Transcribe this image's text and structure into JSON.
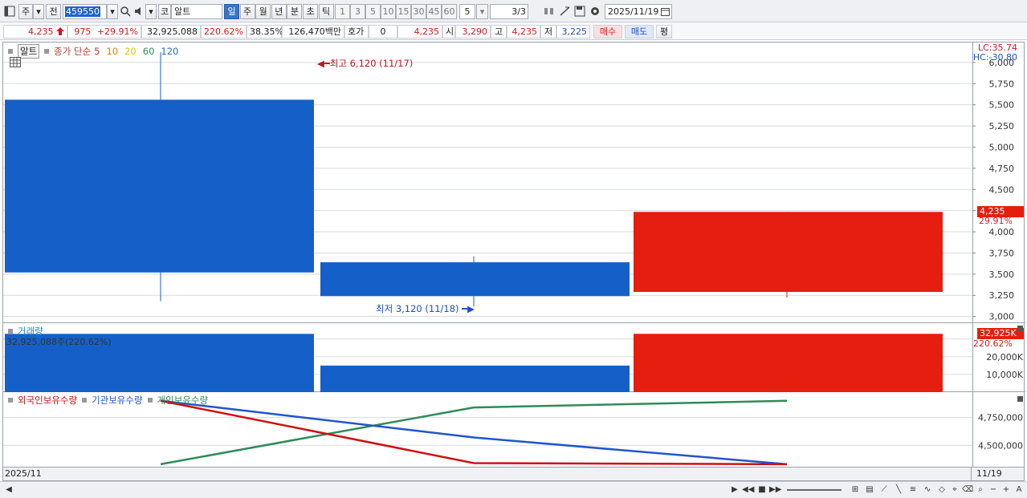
{
  "toolbar": {
    "market_type": "주",
    "prev_label": "전",
    "stock_code": "459550",
    "search_icon": "magnifier",
    "sound_icon": "speaker",
    "exchange_label": "코",
    "stock_name": "알트",
    "periods": [
      {
        "label": "일",
        "active": true
      },
      {
        "label": "주",
        "active": false
      },
      {
        "label": "월",
        "active": false
      },
      {
        "label": "년",
        "active": false
      },
      {
        "label": "분",
        "active": false
      },
      {
        "label": "초",
        "active": false
      },
      {
        "label": "틱",
        "active": false
      }
    ],
    "intervals": [
      "1",
      "3",
      "5",
      "10",
      "15",
      "30",
      "45",
      "60"
    ],
    "interval_value": "5",
    "count_value": "3",
    "count_total": "/3",
    "date_value": "2025/11/19"
  },
  "quote": {
    "price": "4,235",
    "price_arrow": "up-arrow",
    "change": "975",
    "change_pct": "+29.91%",
    "volume": "32,925,088",
    "volume_ratio": "220.62%",
    "turnover_rate": "38.35%",
    "amount": "126,470백만",
    "quote_label": "호가",
    "quote_value": "0",
    "quote_price": "4,235",
    "open_label": "시",
    "open_value": "3,290",
    "high_label": "고",
    "high_value": "4,235",
    "low_label": "저",
    "low_value": "3,225",
    "buy_label": "매수",
    "sell_label": "매도",
    "avg_label": "평"
  },
  "price_pane": {
    "legend": {
      "tag": "알트",
      "series_label": "종가 단순",
      "ma": [
        {
          "label": "5",
          "color": "#c0392b"
        },
        {
          "label": "10",
          "color": "#e07b00"
        },
        {
          "label": "20",
          "color": "#e6c300"
        },
        {
          "label": "60",
          "color": "#2e8b57"
        },
        {
          "label": "120",
          "color": "#2b6cb0"
        }
      ]
    },
    "lc_label": "LC:35.74",
    "hc_label": "HC:-30.80",
    "high_annotation": "최고 6,120 (11/17)",
    "low_annotation": "최저 3,120 (11/18)",
    "current_price_tag": "4,235",
    "current_change_tag": "29.91%",
    "up_color": "#e61e10",
    "down_color": "#1560c8"
  },
  "volume_pane": {
    "label": "거래량",
    "info": "32,925,088주(220.62%)",
    "current_tag": "32,925K",
    "current_pct": "220.62%"
  },
  "holdings_pane": {
    "legend": [
      {
        "label": "외국인보유수량",
        "color": "#cc1111"
      },
      {
        "label": "기관보유수량",
        "color": "#2255cc"
      },
      {
        "label": "개인보유수량",
        "color": "#2e8b57"
      }
    ]
  },
  "status": {
    "period": "2025/11",
    "current_date": "11/19"
  },
  "chart_data": [
    {
      "type": "candlestick",
      "categories": [
        "11/17",
        "11/18",
        "11/19"
      ],
      "series": [
        {
          "open": 5560,
          "high": 6120,
          "low": 3180,
          "close": 3520,
          "direction": "down"
        },
        {
          "open": 3640,
          "high": 3710,
          "low": 3120,
          "close": 3240,
          "direction": "down"
        },
        {
          "open": 3290,
          "high": 4235,
          "low": 3225,
          "close": 4235,
          "direction": "up"
        }
      ],
      "ylim": [
        3000,
        6120
      ],
      "yticks": [
        3000,
        3250,
        3500,
        3750,
        4000,
        4250,
        4500,
        4750,
        5000,
        5250,
        5500,
        5750,
        6000
      ],
      "yticks_labels": [
        "3,000",
        "3,250",
        "3,500",
        "3,750",
        "4,000",
        "4,250",
        "4,500",
        "4,750",
        "5,000",
        "5,250",
        "5,500",
        "5,750",
        "6,000"
      ]
    },
    {
      "type": "bar",
      "categories": [
        "11/17",
        "11/18",
        "11/19"
      ],
      "values": [
        32900000,
        15000000,
        32925088
      ],
      "directions": [
        "down",
        "down",
        "up"
      ],
      "ylim": [
        0,
        33500000
      ],
      "yticks": [
        10000000,
        20000000
      ],
      "yticks_labels": [
        "10,000K",
        "20,000K"
      ]
    },
    {
      "type": "line",
      "categories": [
        "11/17",
        "11/18",
        "11/19"
      ],
      "series": [
        {
          "name": "외국인보유수량",
          "values": [
            4900000,
            4340000,
            4330000
          ]
        },
        {
          "name": "기관보유수량",
          "values": [
            4900000,
            4570000,
            4330000
          ]
        },
        {
          "name": "개인보유수량",
          "values": [
            4330000,
            4840000,
            4900000
          ]
        }
      ],
      "ylim": [
        4300000,
        4920000
      ],
      "yticks": [
        4500000,
        4750000
      ],
      "yticks_labels": [
        "4,500,000",
        "4,750,000"
      ]
    }
  ]
}
